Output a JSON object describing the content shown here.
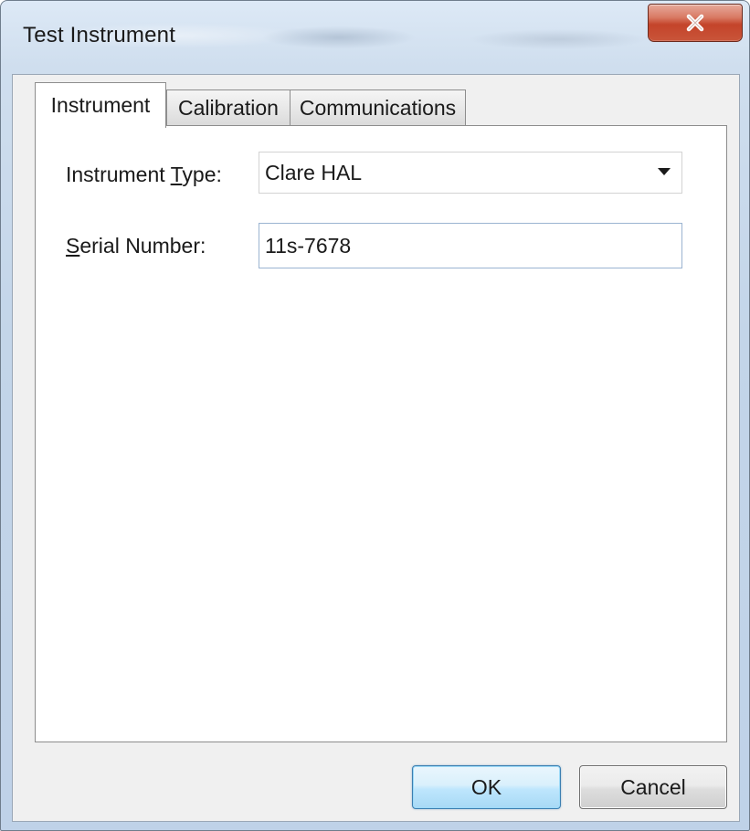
{
  "window": {
    "title": "Test Instrument"
  },
  "icons": {
    "close": "close-icon",
    "dropdown": "chevron-down-icon"
  },
  "tabs": [
    {
      "label": "Instrument",
      "active": true
    },
    {
      "label": "Calibration",
      "active": false
    },
    {
      "label": "Communications",
      "active": false
    }
  ],
  "form": {
    "instrument_type": {
      "label_pre": "Instrument ",
      "label_accel": "T",
      "label_post": "ype:",
      "value": "Clare HAL"
    },
    "serial_number": {
      "label_pre": "",
      "label_accel": "S",
      "label_post": "erial Number:",
      "value": "11s-7678"
    }
  },
  "buttons": {
    "ok": "OK",
    "cancel": "Cancel"
  },
  "colors": {
    "close_button": "#c9553a",
    "ok_button_border": "#3c7fb1",
    "panel_background": "#ffffff",
    "dialog_background": "#f0f0f0"
  }
}
